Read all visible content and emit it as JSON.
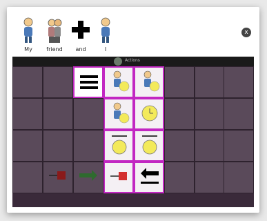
{
  "message_bar": {
    "words": [
      {
        "text": "My",
        "icon": "person-pointing-self-icon"
      },
      {
        "text": "friend",
        "icon": "two-people-icon"
      },
      {
        "text": "and",
        "icon": "plus-cross-icon"
      },
      {
        "text": "I",
        "icon": "person-pointing-self-icon"
      }
    ],
    "clear_icon": "x"
  },
  "title_bar": {
    "title": "Actions"
  },
  "colors": {
    "accent": "#c227c2",
    "grid_bg": "#3a2a3a",
    "cell_dim": "#5a4a5a"
  }
}
